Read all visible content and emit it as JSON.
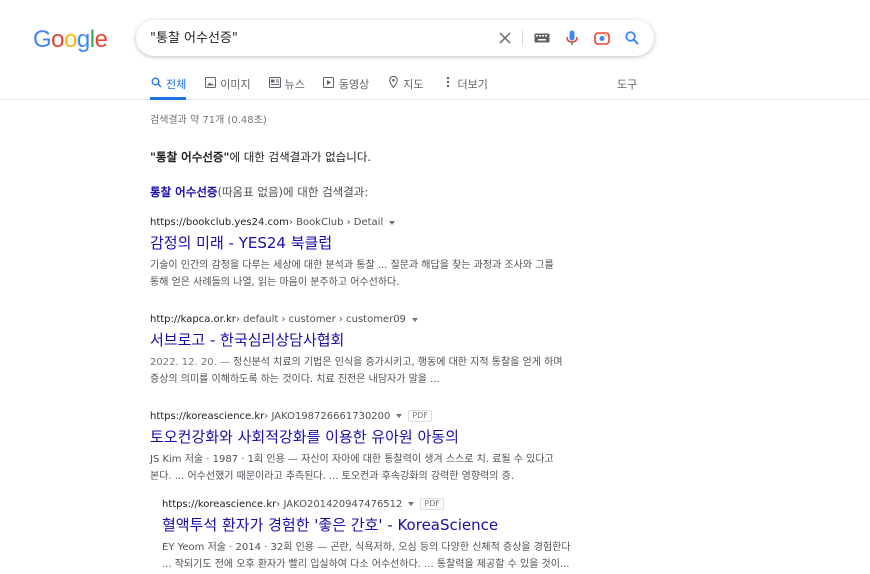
{
  "logo": {
    "letters": [
      "G",
      "o",
      "o",
      "g",
      "l",
      "e"
    ],
    "colors": [
      "#4285f4",
      "#ea4335",
      "#fbbc05",
      "#4285f4",
      "#34a853",
      "#ea4335"
    ]
  },
  "search": {
    "query": "\"통찰 어수선증\""
  },
  "tabs": [
    {
      "label": "전체",
      "icon": "search-icon"
    },
    {
      "label": "이미지",
      "icon": "image-icon"
    },
    {
      "label": "뉴스",
      "icon": "news-icon"
    },
    {
      "label": "동영상",
      "icon": "video-icon"
    },
    {
      "label": "지도",
      "icon": "map-pin-icon"
    },
    {
      "label": "더보기",
      "icon": "more-icon"
    }
  ],
  "tools_label": "도구",
  "stats": "검색결과 약 71개 (0.48초)",
  "notice": {
    "query_bold": "\"통찰 어수선증\"",
    "suffix": "에 대한 검색결과가 없습니다.",
    "alt_query": "통찰 어수선증",
    "alt_suffix": "(따옴표 없음)에 대한 검색결과:"
  },
  "results": [
    {
      "domain": "https://bookclub.yes24.com",
      "path": " › BookClub › Detail",
      "title": "감정의 미래 - YES24 북클럽",
      "line1": "기술이 인간의 감정을 다루는 세상에 대한 분석과 통찰 ... 질문과 해답을 찾는 과정과 조사와 그를",
      "line2": "통해 얻은 사례들의 나열, 읽는 마음이 분주하고 어수선하다."
    },
    {
      "domain": "http://kapca.or.kr",
      "path": " › default › customer › customer09",
      "title": "서브로고 - 한국심리상담사협회",
      "date": "2022. 12. 20. — ",
      "line1": "정신분석 치료의 기법은 인식을 증가시키고, 행동에 대한 지적 통찰을 얻게 하며",
      "line2": "증상의 의미를 이해하도록 하는 것이다. 치료 진전은 내담자가 말을 ..."
    },
    {
      "domain": "https://koreascience.kr",
      "path": " › JAKO198726661730200",
      "pdf": "PDF",
      "title": "토오컨강화와 사회적강화를 이용한 유아원 아동의",
      "line1": "JS Kim 저술 · 1987 · 1회 인용 — 자신이 자아에 대한 통찰력이 생겨 스스로 치. 료될 수 있다고",
      "line2": "본다. ... 어수선했기 때문이라고 추측된다. ... 토오컨과 후속강화의 강력한 영향력의 증."
    },
    {
      "domain": "https://koreascience.kr",
      "path": " › JAKO201420947476512",
      "pdf": "PDF",
      "title": "혈액투석 환자가 경험한 '좋은 간호' - KoreaScience",
      "line1": "EY Yeom 저술 · 2014 · 32회 인용 — 곤란, 식욕저하, 오심 등의 다양한 신체적 증상을 경험한다",
      "line2": "... 작되기도 전에 오후 환자가 빨리 입실하여 다소 어수선하다. ... 통찰력을 제공할 수 있을 것이..."
    }
  ]
}
